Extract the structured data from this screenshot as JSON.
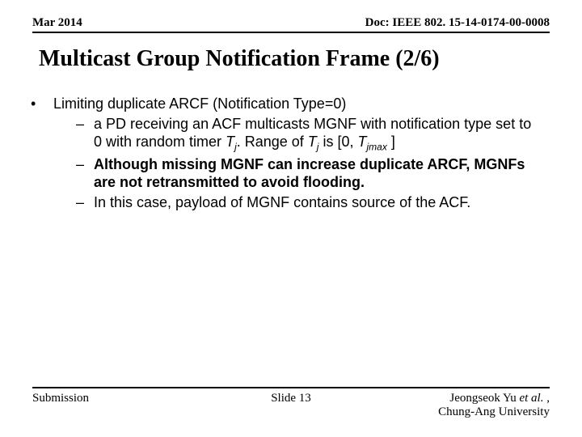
{
  "header": {
    "date": "Mar 2014",
    "doc": "Doc: IEEE 802. 15-14-0174-00-0008"
  },
  "title": "Multicast Group Notification Frame (2/6)",
  "bullet": {
    "mark": "•",
    "text": "Limiting duplicate ARCF (Notification Type=0)"
  },
  "subs": {
    "dash": "–",
    "s1a": "a PD receiving an ACF multicasts MGNF with notification type set to 0 with random timer ",
    "s1b": ". Range of ",
    "s1c": " is [0, ",
    "s1d": " ]",
    "tj": "T",
    "j": "j",
    "jmax": "jmax",
    "s2": "Although missing MGNF can increase duplicate ARCF, MGNFs are not retransmitted to avoid flooding.",
    "s3": "In this case, payload of MGNF contains source of the ACF."
  },
  "footer": {
    "left": "Submission",
    "center": "Slide 13",
    "right1": "Jeongseok Yu ",
    "right1b": "et al.",
    "right1c": " ,",
    "right2": "Chung-Ang University"
  }
}
